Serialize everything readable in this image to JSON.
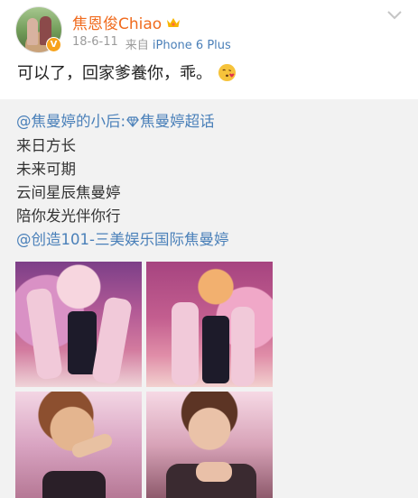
{
  "post": {
    "username": "焦恩俊Chiao",
    "verified_badge": "V",
    "date": "18-6-11",
    "source_prefix": "来自",
    "device": "iPhone 6 Plus",
    "text": "可以了，回家爹養你，乖。",
    "icons": {
      "avatar": "avatar-photo",
      "badge": "verified-badge-icon",
      "username_icon": "crown-icon",
      "menu": "chevron-down-icon",
      "emoji": "kiss-face-icon"
    },
    "colors": {
      "username": "#f06b1e",
      "device": "#4a7fb8",
      "badge": "#f7a21b"
    }
  },
  "repost": {
    "mention_user": "@焦曼婷的小后",
    "topic_separator": ":",
    "topic": "焦曼婷超话",
    "lines": [
      "来日方长",
      "未来可期",
      "云间星辰焦曼婷",
      "陪你发光伴你行"
    ],
    "footer_mention": "@创造101-三美娱乐国际焦曼婷",
    "link_color": "#4a80b9",
    "background": "#f2f2f2"
  }
}
